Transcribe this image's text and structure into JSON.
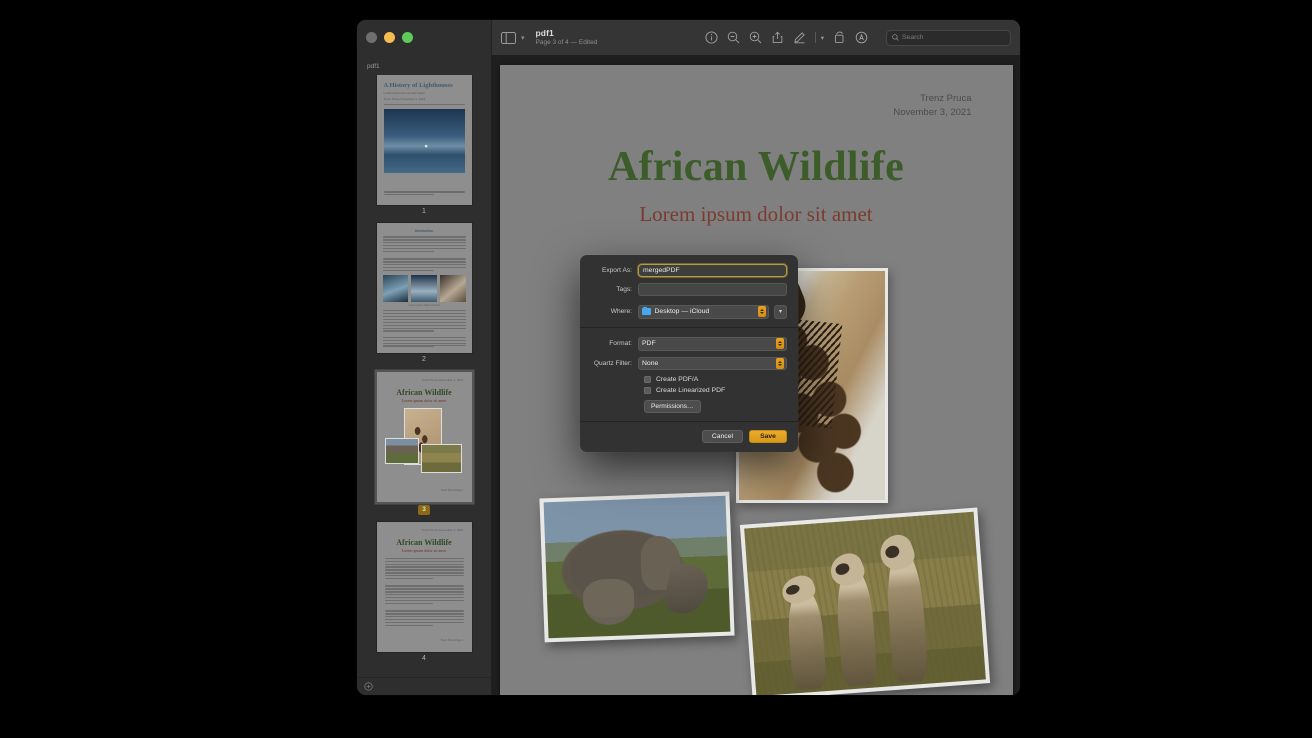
{
  "window": {
    "traffic_lights": [
      "close",
      "minimize",
      "zoom"
    ],
    "toolbar": {
      "sidebar_toggle_icon": "sidebar-icon",
      "sidebar_chevron_icon": "chevron-down-icon",
      "doc_title": "pdf1",
      "doc_subtitle": "Page 3 of 4 — Edited",
      "tools": [
        {
          "name": "info-icon",
          "glyph": "info"
        },
        {
          "name": "zoom-out-icon",
          "glyph": "zoom-out"
        },
        {
          "name": "zoom-in-icon",
          "glyph": "zoom-in"
        },
        {
          "name": "share-icon",
          "glyph": "share"
        },
        {
          "name": "markup-icon",
          "glyph": "pen"
        },
        {
          "name": "markup-chevron-icon",
          "glyph": "chevron"
        },
        {
          "name": "rotate-icon",
          "glyph": "rotate"
        },
        {
          "name": "annotate-icon",
          "glyph": "circle-a"
        }
      ],
      "search": {
        "placeholder": "Search",
        "value": "",
        "icon": "search-icon"
      }
    }
  },
  "sidebar": {
    "title": "pdf1",
    "bottom_icon": "add-page-icon",
    "thumbnails": [
      {
        "page": "1",
        "selected": false,
        "doc_heading": "A History of Lighthouses",
        "doc_subheading": "Lorem ipsum dolor sit amet fugiat",
        "doc_byline": "Trenz Pruca  November 3, 2021"
      },
      {
        "page": "2",
        "selected": false,
        "doc_heading": "Introduction",
        "caption": "Lorem ipsum dolor sit amet"
      },
      {
        "page": "3",
        "selected": true,
        "doc_heading": "African Wildlife",
        "doc_subheading": "Lorem ipsum dolor sit amet",
        "doc_byline": "Trenz Pruca  November 3, 2021"
      },
      {
        "page": "4",
        "selected": false,
        "doc_heading": "African Wildlife",
        "doc_subheading": "Lorem ipsum dolor sit amet",
        "doc_byline": "Trenz Pruca  November 3, 2021"
      }
    ]
  },
  "document": {
    "author": "Trenz Pruca",
    "date": "November 3, 2021",
    "title": "African Wildlife",
    "subtitle": "Lorem ipsum dolor sit amet",
    "title_color": "#3c5c2a",
    "subtitle_color": "#7a3c2e",
    "photos": [
      {
        "name": "giraffe-photo",
        "subject": "giraffe"
      },
      {
        "name": "elephant-photo",
        "subject": "elephant and calf"
      },
      {
        "name": "meerkat-photo",
        "subject": "three meerkats"
      }
    ]
  },
  "dialog": {
    "export_as": {
      "label": "Export As:",
      "value": "mergedPDF",
      "focused": true
    },
    "tags": {
      "label": "Tags:",
      "value": "",
      "placeholder": ""
    },
    "where": {
      "label": "Where:",
      "value": "Desktop — iCloud",
      "icon": "folder-icon"
    },
    "format": {
      "label": "Format:",
      "value": "PDF"
    },
    "quartz_filter": {
      "label": "Quartz Filter:",
      "value": "None"
    },
    "create_pdfa": {
      "label": "Create PDF/A",
      "checked": false
    },
    "create_linearized": {
      "label": "Create Linearized PDF",
      "checked": false
    },
    "permissions_button": "Permissions…",
    "cancel_button": "Cancel",
    "save_button": "Save",
    "accent_color": "#e0a11e",
    "focus_ring_color": "#b89b3a"
  }
}
